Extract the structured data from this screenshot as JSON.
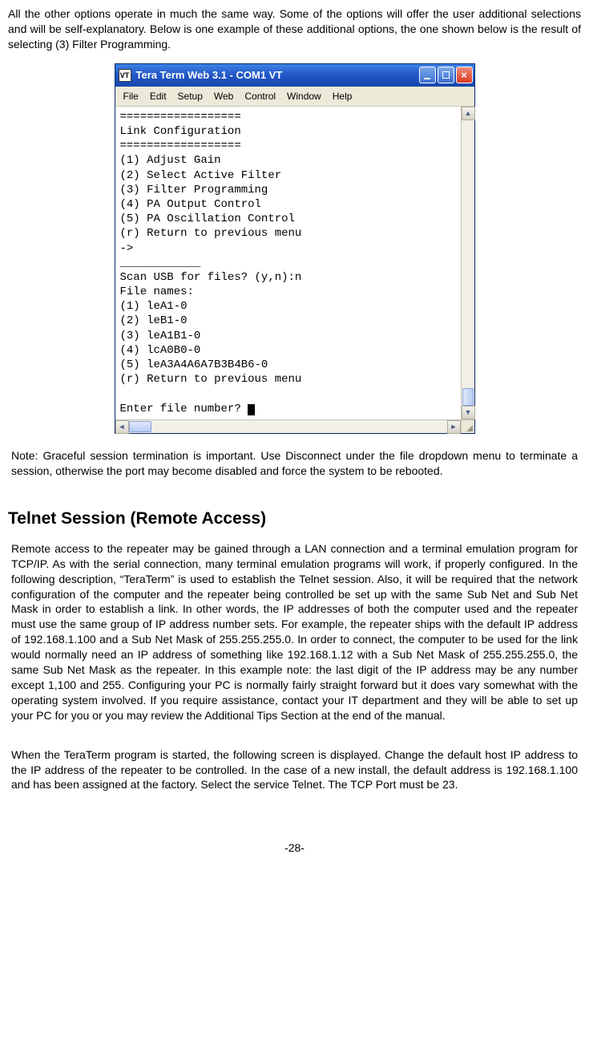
{
  "intro_para": "All the other options operate in much the same way. Some of the options will offer the user additional selections and will be self-explanatory. Below is one example of these additional options, the one shown below is the result of selecting (3) Filter Programming.",
  "window": {
    "icon_text": "VT",
    "title": "Tera Term Web 3.1 - COM1 VT",
    "menu": [
      "File",
      "Edit",
      "Setup",
      "Web",
      "Control",
      "Window",
      "Help"
    ],
    "terminal_lines": [
      "==================",
      "Link Configuration",
      "==================",
      "(1) Adjust Gain",
      "(2) Select Active Filter",
      "(3) Filter Programming",
      "(4) PA Output Control",
      "(5) PA Oscillation Control",
      "(r) Return to previous menu",
      "->",
      "____________",
      "Scan USB for files? (y,n):n",
      "File names:",
      "(1) leA1-0",
      "(2) leB1-0",
      "(3) leA1B1-0",
      "(4) lcA0B0-0",
      "(5) leA3A4A6A7B3B4B6-0",
      "(r) Return to previous menu",
      "",
      "Enter file number? "
    ]
  },
  "note": "Note: Graceful session termination is important. Use Disconnect under the file dropdown menu to terminate a session, otherwise the port may become disabled and force the system to be rebooted.",
  "section_heading": "Telnet Session (Remote Access)",
  "telnet_para1": "Remote access to the repeater may be gained through a LAN connection and a terminal emulation program for TCP/IP. As with the serial connection, many terminal emulation programs will work, if properly configured.  In the following description, “TeraTerm” is used to establish the Telnet session. Also, it will be required that the network configuration of the computer and the repeater being controlled be set up with the same Sub Net and Sub Net Mask in order to establish a link. In other words, the IP addresses of both the computer used and the repeater must use the same group of IP address number sets. For example, the repeater ships with the default IP address of 192.168.1.100 and a Sub Net Mask of 255.255.255.0. In order to connect, the computer to be used for the link would normally need an IP address of something like 192.168.1.12 with a Sub Net Mask of 255.255.255.0, the same Sub Net Mask as the repeater. In this example note: the last digit of the IP address may be any number except 1,100 and 255. Configuring your PC is normally fairly straight forward but it does vary somewhat with the operating system involved.  If you require assistance, contact your IT department and they will be able to set up your PC for you or you may review the Additional Tips Section at the end of the manual.",
  "telnet_para2": "When the TeraTerm program is started, the following screen is displayed. Change the default host IP address to the IP address of the repeater to be controlled. In the case of a new install, the default address is 192.168.1.100 and has been assigned at the factory. Select the service Telnet. The TCP Port must be 23.",
  "page_number": "-28-"
}
